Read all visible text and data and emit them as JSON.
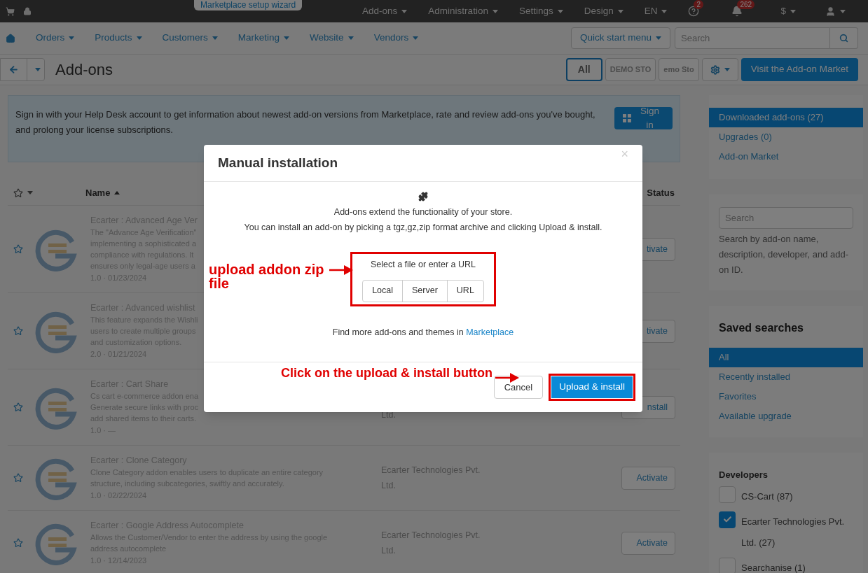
{
  "tooltip": "Marketplace setup wizard",
  "top_bar": {
    "menus": [
      "Add-ons",
      "Administration",
      "Settings",
      "Design",
      "EN"
    ],
    "help_badge": "2",
    "notifications_badge": "262",
    "currency": "$"
  },
  "nav": {
    "items": [
      "Orders",
      "Products",
      "Customers",
      "Marketing",
      "Website",
      "Vendors"
    ],
    "quick_start": "Quick start menu",
    "search_placeholder": "Search"
  },
  "header": {
    "title": "Add-ons",
    "storefronts": [
      {
        "label": "All",
        "selected": true
      },
      {
        "label": "DEMO STO",
        "selected": false
      },
      {
        "label": "emo Sto",
        "selected": false
      }
    ],
    "market_button": "Visit the Add-on Market"
  },
  "notice": {
    "text": "Sign in with your Help Desk account to get information about newest add-on versions from Marketplace, rate and review add-ons you've bought, and prolong your license subscriptions.",
    "button": "Sign in"
  },
  "table": {
    "columns": [
      "Name",
      "Status"
    ],
    "rows": [
      {
        "name": "Ecarter : Advanced Age Ver",
        "description_lines": [
          "The \"Advance Age Verification\"",
          "implementing a sophisticated a",
          "compliance with regulations. It",
          "ensures only legal-age users a"
        ],
        "meta": "1.0 · 01/23/2024",
        "developer_lines": [],
        "action": "tivate"
      },
      {
        "name": "Ecarter : Advanced wishlist",
        "description_lines": [
          "This feature expands the Wishli",
          "users to create multiple groups",
          "and customization options."
        ],
        "meta": "2.0 · 01/21/2024",
        "developer_lines": [],
        "action": "tivate"
      },
      {
        "name": "Ecarter : Cart Share",
        "description_lines": [
          "Cs cart e-commerce addon ena",
          "Generate secure links with proc",
          "add shared items to their carts."
        ],
        "meta": "1.0 · —",
        "developer_lines": [
          "Ltd."
        ],
        "action": "nstall"
      },
      {
        "name": "Ecarter : Clone Category",
        "description_lines": [
          "Clone Category addon enables users to duplicate an entire category",
          "structure, including subcategories, swiftly and accurately."
        ],
        "meta": "1.0 · 02/22/2024",
        "developer_lines": [
          "Ecarter Technologies Pvt.",
          "Ltd."
        ],
        "action": "Activate"
      },
      {
        "name": "Ecarter : Google Address Autocomplete",
        "description_lines": [
          "Allows the Customer/Vendor to enter the address by using the google",
          "address autocomplete"
        ],
        "meta": "1.0 · 12/14/2023",
        "developer_lines": [
          "Ecarter Technologies Pvt.",
          "Ltd."
        ],
        "action": "Activate"
      }
    ]
  },
  "sidebar": {
    "views": [
      {
        "label": "Downloaded add-ons (27)",
        "selected": true
      },
      {
        "label": "Upgrades (0)",
        "selected": false
      },
      {
        "label": "Add-on Market",
        "selected": false
      }
    ],
    "search": {
      "placeholder": "Search",
      "help": "Search by add-on name, description, developer, and add-on ID."
    },
    "saved_searches": {
      "title": "Saved searches",
      "items": [
        {
          "label": "All",
          "selected": true
        },
        {
          "label": "Recently installed",
          "selected": false
        },
        {
          "label": "Favorites",
          "selected": false
        },
        {
          "label": "Available upgrade",
          "selected": false
        }
      ]
    },
    "developers": {
      "title": "Developers",
      "items": [
        {
          "label": "CS-Cart (87)",
          "checked": false
        },
        {
          "label": "Ecarter Technologies Pvt. Ltd. (27)",
          "checked": true
        },
        {
          "label": "Searchanise (1)",
          "checked": false
        }
      ]
    }
  },
  "modal": {
    "title": "Manual installation",
    "close": "×",
    "lines": [
      "Add-ons extend the functionality of your store.",
      "You can install an add-on by picking a tgz,gz,zip format archive and clicking Upload & install."
    ],
    "source_prompt": "Select a file or enter a URL",
    "sources": [
      "Local",
      "Server",
      "URL"
    ],
    "more_text": "Find more add-ons and themes in",
    "more_link": "Marketplace",
    "cancel": "Cancel",
    "submit": "Upload & install"
  },
  "annotations": [
    {
      "kind": "upload",
      "text": "upload addon zip file"
    },
    {
      "kind": "install",
      "text": "Click on the upload & install button"
    }
  ]
}
